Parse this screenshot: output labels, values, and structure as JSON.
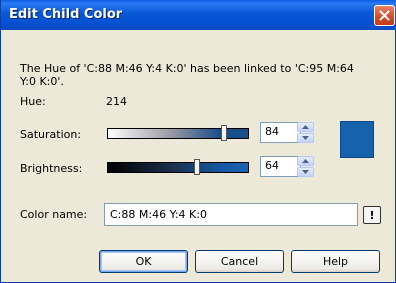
{
  "window": {
    "title": "Edit Child Color"
  },
  "message": {
    "line1": "The Hue of 'C:88 M:46 Y:4 K:0' has been linked to 'C:95 M:64",
    "line2": "Y:0 K:0'."
  },
  "hue": {
    "label": "Hue:",
    "value": "214"
  },
  "saturation": {
    "label": "Saturation:",
    "value": "84",
    "level_percent": 84
  },
  "brightness": {
    "label": "Brightness:",
    "value": "64",
    "level_percent": 64
  },
  "swatch": {
    "color": "#1763ab"
  },
  "color_name": {
    "label": "Color name:",
    "value": "C:88 M:46 Y:4 K:0",
    "lock_glyph": "!"
  },
  "buttons": {
    "ok": "OK",
    "cancel": "Cancel",
    "help": "Help"
  }
}
